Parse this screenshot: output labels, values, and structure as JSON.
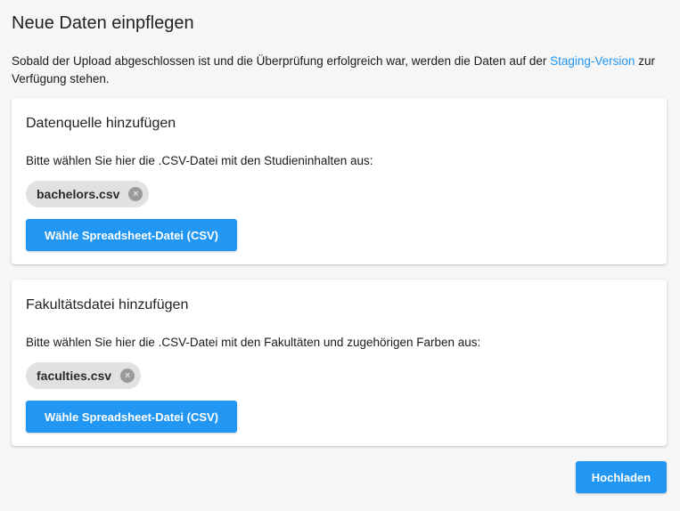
{
  "page": {
    "title": "Neue Daten einpflegen",
    "intro_text": "Sobald der Upload abgeschlossen ist und die Überprüfung erfolgreich war, werden die Daten auf der ",
    "intro_link": "Staging-Version",
    "intro_suffix": " zur Verfügung stehen."
  },
  "cards": [
    {
      "title": "Datenquelle hinzufügen",
      "description": "Bitte wählen Sie hier die .CSV-Datei mit den Studieninhalten aus:",
      "file_chip": "bachelors.csv",
      "button_label": "Wähle Spreadsheet-Datei (CSV)"
    },
    {
      "title": "Fakultätsdatei hinzufügen",
      "description": "Bitte wählen Sie hier die .CSV-Datei mit den Fakultäten und zugehörigen Farben aus:",
      "file_chip": "faculties.csv",
      "button_label": "Wähle Spreadsheet-Datei (CSV)"
    }
  ],
  "actions": {
    "upload_label": "Hochladen"
  },
  "icons": {
    "chip_remove": "close-circle-icon",
    "chip_remove_glyph": "×"
  },
  "colors": {
    "accent": "#2196f3",
    "chip_bg": "#e1e1e1",
    "page_bg": "#f6f6f6"
  }
}
